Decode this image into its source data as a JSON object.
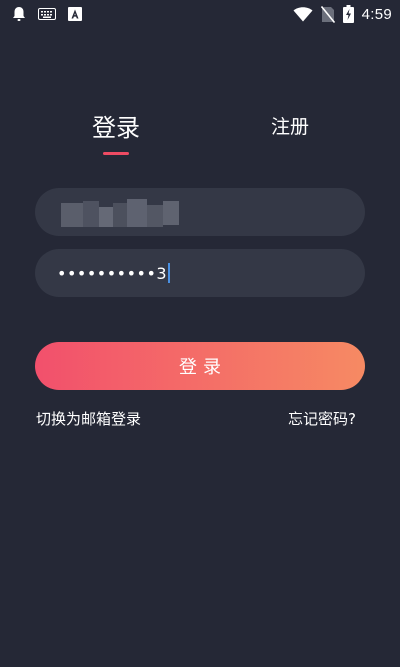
{
  "status_bar": {
    "time": "4:59",
    "icons": [
      "notification-bell-icon",
      "keyboard-icon",
      "android-a-icon",
      "wifi-icon",
      "no-sim-icon",
      "battery-charging-icon"
    ]
  },
  "tabs": [
    {
      "label": "登录",
      "active": true
    },
    {
      "label": "注册",
      "active": false
    }
  ],
  "form": {
    "username": {
      "value": "",
      "obscured": true
    },
    "password": {
      "value": "••••••••••3"
    }
  },
  "login_button": {
    "label": "登录"
  },
  "links": {
    "switch_email": "切换为邮箱登录",
    "forgot_password": "忘记密码?"
  },
  "colors": {
    "background": "#252836",
    "field": "#343846",
    "accent": "#ee4b63",
    "gradient_start": "#f2506c",
    "gradient_end": "#f68a63",
    "caret": "#4a90e2"
  }
}
